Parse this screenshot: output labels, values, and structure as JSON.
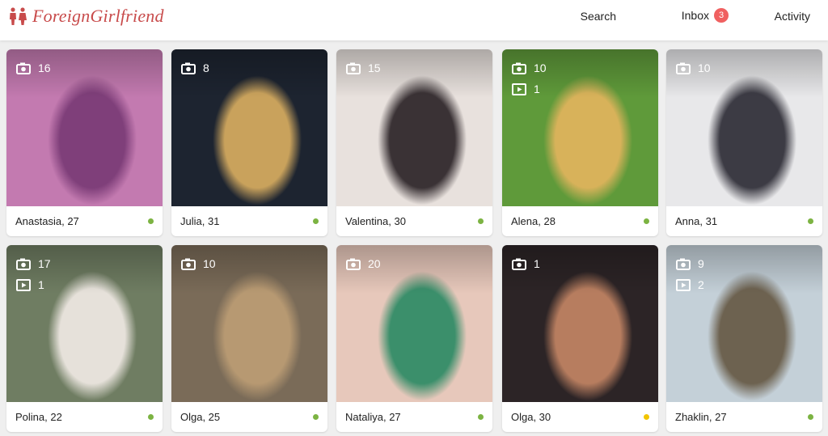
{
  "header": {
    "logo_text": "ForeignGirlfriend",
    "brand_color": "#c84b4b",
    "nav": {
      "search": "Search",
      "inbox": "Inbox",
      "inbox_badge": "3",
      "activity": "Activity"
    }
  },
  "profiles": [
    {
      "name": "Anastasia, 27",
      "photos": "16",
      "videos": "",
      "status": "online",
      "status_color": "#7cb342",
      "photo_colors": [
        "#c37ab0",
        "#7f3f7a"
      ]
    },
    {
      "name": "Julia, 31",
      "photos": "8",
      "videos": "",
      "status": "online",
      "status_color": "#7cb342",
      "photo_colors": [
        "#1d2430",
        "#c9a25c"
      ]
    },
    {
      "name": "Valentina, 30",
      "photos": "15",
      "videos": "",
      "status": "online",
      "status_color": "#7cb342",
      "photo_colors": [
        "#e8e1dd",
        "#3a3235"
      ]
    },
    {
      "name": "Alena, 28",
      "photos": "10",
      "videos": "1",
      "status": "online",
      "status_color": "#7cb342",
      "photo_colors": [
        "#5f9a3a",
        "#d8b25a"
      ]
    },
    {
      "name": "Anna, 31",
      "photos": "10",
      "videos": "",
      "status": "online",
      "status_color": "#7cb342",
      "photo_colors": [
        "#e8e8ea",
        "#3c3b44"
      ]
    },
    {
      "name": "Polina, 22",
      "photos": "17",
      "videos": "1",
      "status": "online",
      "status_color": "#7cb342",
      "photo_colors": [
        "#6f7d62",
        "#e6e1da"
      ]
    },
    {
      "name": "Olga, 25",
      "photos": "10",
      "videos": "",
      "status": "online",
      "status_color": "#7cb342",
      "photo_colors": [
        "#7a6b58",
        "#b79972"
      ]
    },
    {
      "name": "Nataliya, 27",
      "photos": "20",
      "videos": "",
      "status": "online",
      "status_color": "#7cb342",
      "photo_colors": [
        "#e7c8bb",
        "#3b8f6b"
      ]
    },
    {
      "name": "Olga, 30",
      "photos": "1",
      "videos": "",
      "status": "away",
      "status_color": "#f2c500",
      "photo_colors": [
        "#2c2426",
        "#b77d5f"
      ]
    },
    {
      "name": "Zhaklin, 27",
      "photos": "9",
      "videos": "2",
      "status": "online",
      "status_color": "#7cb342",
      "photo_colors": [
        "#c4d0d8",
        "#6d6250"
      ]
    }
  ]
}
